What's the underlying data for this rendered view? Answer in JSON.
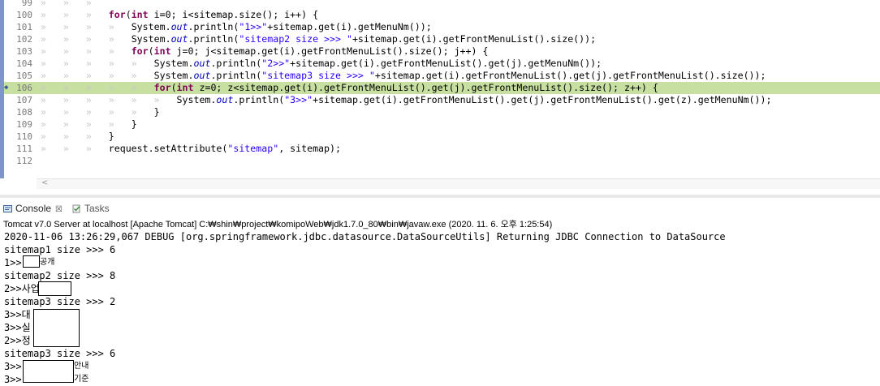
{
  "editor": {
    "tab_glyph": "»",
    "lines": [
      {
        "num": "99",
        "tabs": 3,
        "parts": []
      },
      {
        "num": "100",
        "tabs": 3,
        "parts": [
          [
            "kw",
            "for"
          ],
          [
            "n",
            "("
          ],
          [
            "kw",
            "int"
          ],
          [
            "n",
            " i=0; i<sitemap.size(); i++) {"
          ]
        ]
      },
      {
        "num": "101",
        "tabs": 4,
        "parts": [
          [
            "n",
            "System."
          ],
          [
            "fld",
            "out"
          ],
          [
            "n",
            ".println("
          ],
          [
            "str",
            "\"1>>\""
          ],
          [
            "n",
            "+sitemap.get(i).getMenuNm());"
          ]
        ]
      },
      {
        "num": "102",
        "tabs": 4,
        "parts": [
          [
            "n",
            "System."
          ],
          [
            "fld",
            "out"
          ],
          [
            "n",
            ".println("
          ],
          [
            "str",
            "\"sitemap2 size >>> \""
          ],
          [
            "n",
            "+sitemap.get(i).getFrontMenuList().size());"
          ]
        ]
      },
      {
        "num": "103",
        "tabs": 4,
        "parts": [
          [
            "kw",
            "for"
          ],
          [
            "n",
            "("
          ],
          [
            "kw",
            "int"
          ],
          [
            "n",
            " j=0; j<sitemap.get(i).getFrontMenuList().size(); j++) {"
          ]
        ]
      },
      {
        "num": "104",
        "tabs": 5,
        "parts": [
          [
            "n",
            "System."
          ],
          [
            "fld",
            "out"
          ],
          [
            "n",
            ".println("
          ],
          [
            "str",
            "\"2>>\""
          ],
          [
            "n",
            "+sitemap.get(i).getFrontMenuList().get(j).getMenuNm());"
          ]
        ]
      },
      {
        "num": "105",
        "tabs": 5,
        "parts": [
          [
            "n",
            "System."
          ],
          [
            "fld",
            "out"
          ],
          [
            "n",
            ".println("
          ],
          [
            "str",
            "\"sitemap3 size >>> \""
          ],
          [
            "n",
            "+sitemap.get(i).getFrontMenuList().get(j).getFrontMenuList().size());"
          ]
        ]
      },
      {
        "num": "106",
        "tabs": 5,
        "parts": [
          [
            "kw",
            "for"
          ],
          [
            "n",
            "("
          ],
          [
            "kw",
            "int"
          ],
          [
            "n",
            " z=0; z<sitemap.get(i).getFrontMenuList().get(j).getFrontMenuList().size(); z++) {"
          ]
        ]
      },
      {
        "num": "107",
        "tabs": 6,
        "parts": [
          [
            "n",
            "System."
          ],
          [
            "fld",
            "out"
          ],
          [
            "n",
            ".println("
          ],
          [
            "str",
            "\"3>>\""
          ],
          [
            "n",
            "+sitemap.get(i).getFrontMenuList().get(j).getFrontMenuList().get(z).getMenuNm());"
          ]
        ]
      },
      {
        "num": "108",
        "tabs": 5,
        "parts": [
          [
            "n",
            "}"
          ]
        ]
      },
      {
        "num": "109",
        "tabs": 4,
        "parts": [
          [
            "n",
            "}"
          ]
        ]
      },
      {
        "num": "110",
        "tabs": 3,
        "parts": [
          [
            "n",
            "}"
          ]
        ]
      },
      {
        "num": "111",
        "tabs": 3,
        "parts": [
          [
            "n",
            "request.setAttribute("
          ],
          [
            "str",
            "\"sitemap\""
          ],
          [
            "n",
            ", sitemap);"
          ]
        ]
      },
      {
        "num": "112",
        "tabs": 0,
        "parts": []
      }
    ],
    "highlight_color": "#c7dfa0"
  },
  "console": {
    "console_tab_label": "Console",
    "console_tab_close": "☒",
    "tasks_tab_label": "Tasks",
    "description": "Tomcat v7.0 Server at localhost [Apache Tomcat] C:₩shin₩project₩komipoWeb₩jdk1.7.0_80₩bin₩javaw.exe (2020. 11. 6. 오후 1:25:54)",
    "output": [
      "2020-11-06 13:26:29,067 DEBUG [org.springframework.jdbc.datasource.DataSourceUtils] Returning JDBC Connection to DataSource",
      "sitemap1 size >>> 6",
      "1>>",
      "sitemap2 size >>> 8",
      "2>>사업",
      "sitemap3 size >>> 2",
      "3>>대",
      "3>>실",
      "2>>정",
      "sitemap3 size >>> 6",
      "3>>",
      "3>>"
    ],
    "output_tail": {
      "line3": "공개",
      "line11": "안내",
      "line12": "기준"
    }
  }
}
